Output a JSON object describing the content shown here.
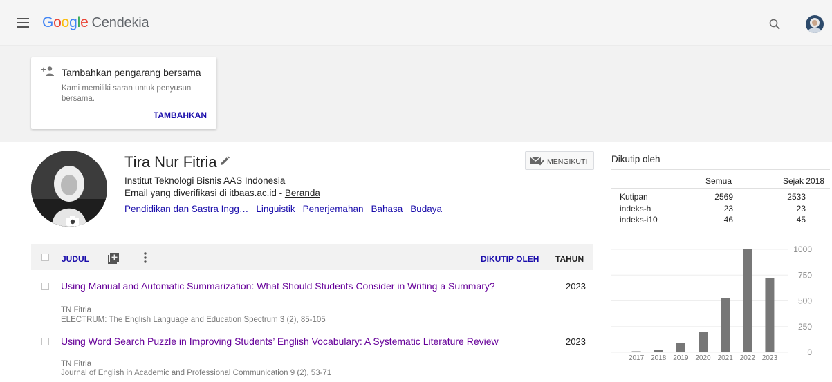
{
  "header": {
    "logo": [
      "G",
      "o",
      "o",
      "g",
      "l",
      "e"
    ],
    "product": "Cendekia"
  },
  "suggest": {
    "title": "Tambahkan pengarang bersama",
    "desc": "Kami memiliki saran untuk penyusun bersama.",
    "action": "TAMBAHKAN"
  },
  "profile": {
    "name": "Tira Nur Fitria",
    "affiliation": "Institut Teknologi Bisnis AAS Indonesia",
    "email_text": "Email yang diverifikasi di itbaas.ac.id - ",
    "homepage": "Beranda",
    "interests": [
      "Pendidikan dan Sastra Ingg…",
      "Linguistik",
      "Penerjemahan",
      "Bahasa",
      "Budaya"
    ],
    "follow_label": "MENGIKUTI"
  },
  "table": {
    "col_title": "JUDUL",
    "col_cited": "DIKUTIP OLEH",
    "col_year": "TAHUN",
    "rows": [
      {
        "title": "Using Manual and Automatic Summarization: What Should Students Consider in Writing a Summary?",
        "authors": "TN Fitria",
        "venue": "ELECTRUM: The English Language and Education Spectrum 3 (2), 85-105",
        "year": "2023"
      },
      {
        "title": "Using Word Search Puzzle in Improving Students’ English Vocabulary: A Systematic Literature Review",
        "authors": "TN Fitria",
        "venue": "Journal of English in Academic and Professional Communication 9 (2), 53-71",
        "year": "2023"
      }
    ]
  },
  "cited_by": {
    "title": "Dikutip oleh",
    "col_all": "Semua",
    "col_since": "Sejak 2018",
    "metrics": [
      {
        "label": "Kutipan",
        "all": "2569",
        "since": "2533"
      },
      {
        "label": "indeks-h",
        "all": "23",
        "since": "23"
      },
      {
        "label": "indeks-i10",
        "all": "46",
        "since": "45"
      }
    ]
  },
  "chart_data": {
    "type": "bar",
    "categories": [
      "2017",
      "2018",
      "2019",
      "2020",
      "2021",
      "2022",
      "2023"
    ],
    "values": [
      10,
      25,
      90,
      195,
      525,
      1000,
      720
    ],
    "ylim": [
      0,
      1000
    ],
    "yticks": [
      0,
      250,
      500,
      750,
      1000
    ],
    "bar_color": "#777777",
    "grid": true
  },
  "colors": {
    "link": "#1a0dab",
    "visited": "#660099",
    "band": "#f2f2f2"
  }
}
